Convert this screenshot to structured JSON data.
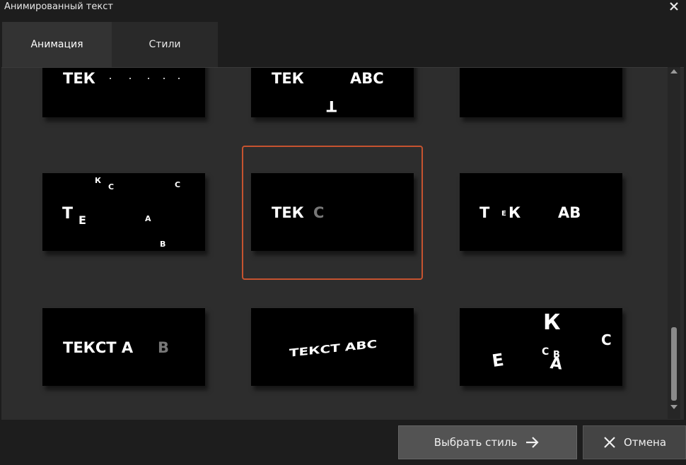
{
  "window": {
    "title": "Анимированный текст"
  },
  "tabs": [
    {
      "label": "Анимация",
      "active": true
    },
    {
      "label": "Стили",
      "active": false
    }
  ],
  "presets": [
    {
      "text": [
        "ТЕК"
      ]
    },
    {
      "text": [
        "ТЕК",
        "АВС",
        "Т"
      ]
    },
    {
      "text": []
    },
    {
      "text": [
        "К",
        "С",
        "С",
        "Т",
        "Е",
        "А",
        "В"
      ]
    },
    {
      "text": [
        "ТЕК",
        "С"
      ],
      "selected": true
    },
    {
      "text": [
        "Т",
        "Е",
        "К",
        "АВ"
      ]
    },
    {
      "text": [
        "ТЕКСТ А",
        "В"
      ]
    },
    {
      "text": [
        "ТЕКСТ АВС"
      ]
    },
    {
      "text": [
        "К",
        "С",
        "С",
        "В",
        "Е",
        "А"
      ]
    }
  ],
  "buttons": {
    "choose_label": "Выбрать стиль",
    "cancel_label": "Отмена"
  },
  "colors": {
    "selection_border": "#c6532f",
    "accent_dim": "#777777"
  },
  "icons": {
    "close": "close-icon",
    "arrow_right": "arrow-right-icon",
    "cancel": "close-icon"
  }
}
